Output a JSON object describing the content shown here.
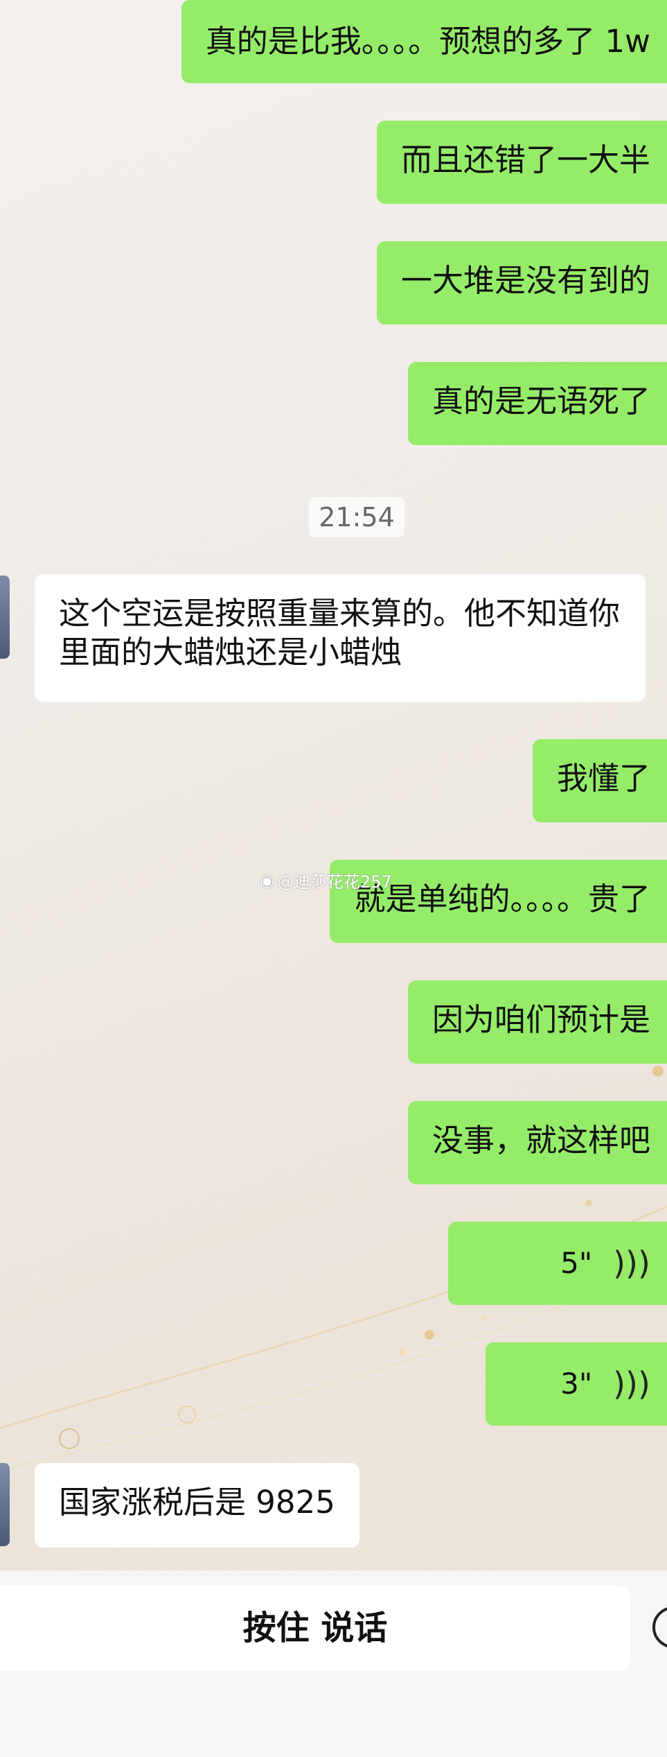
{
  "messages": [
    {
      "side": "me",
      "text": "真的是比我。。。。预想的多了 1w"
    },
    {
      "side": "me",
      "text": "而且还错了一大半"
    },
    {
      "side": "me",
      "text": "一大堆是没有到的"
    },
    {
      "side": "me",
      "text": "真的是无语死了"
    },
    {
      "side": "time",
      "text": "21:54"
    },
    {
      "side": "other",
      "text": "这个空运是按照重量来算的。他不知道你里面的大蜡烛还是小蜡烛"
    },
    {
      "side": "me",
      "text": "我懂了"
    },
    {
      "side": "me",
      "text": "就是单纯的。。。。贵了"
    },
    {
      "side": "me",
      "text": "因为咱们预计是"
    },
    {
      "side": "me",
      "text": "没事，就这样吧"
    },
    {
      "side": "me",
      "type": "voice",
      "duration": "5\""
    },
    {
      "side": "me",
      "type": "voice",
      "duration": "3\""
    },
    {
      "side": "other",
      "text": "国家涨税后是 9825"
    }
  ],
  "watermark": "@迪莎花花257",
  "input_bar": {
    "hold_to_talk": "按住 说话"
  }
}
